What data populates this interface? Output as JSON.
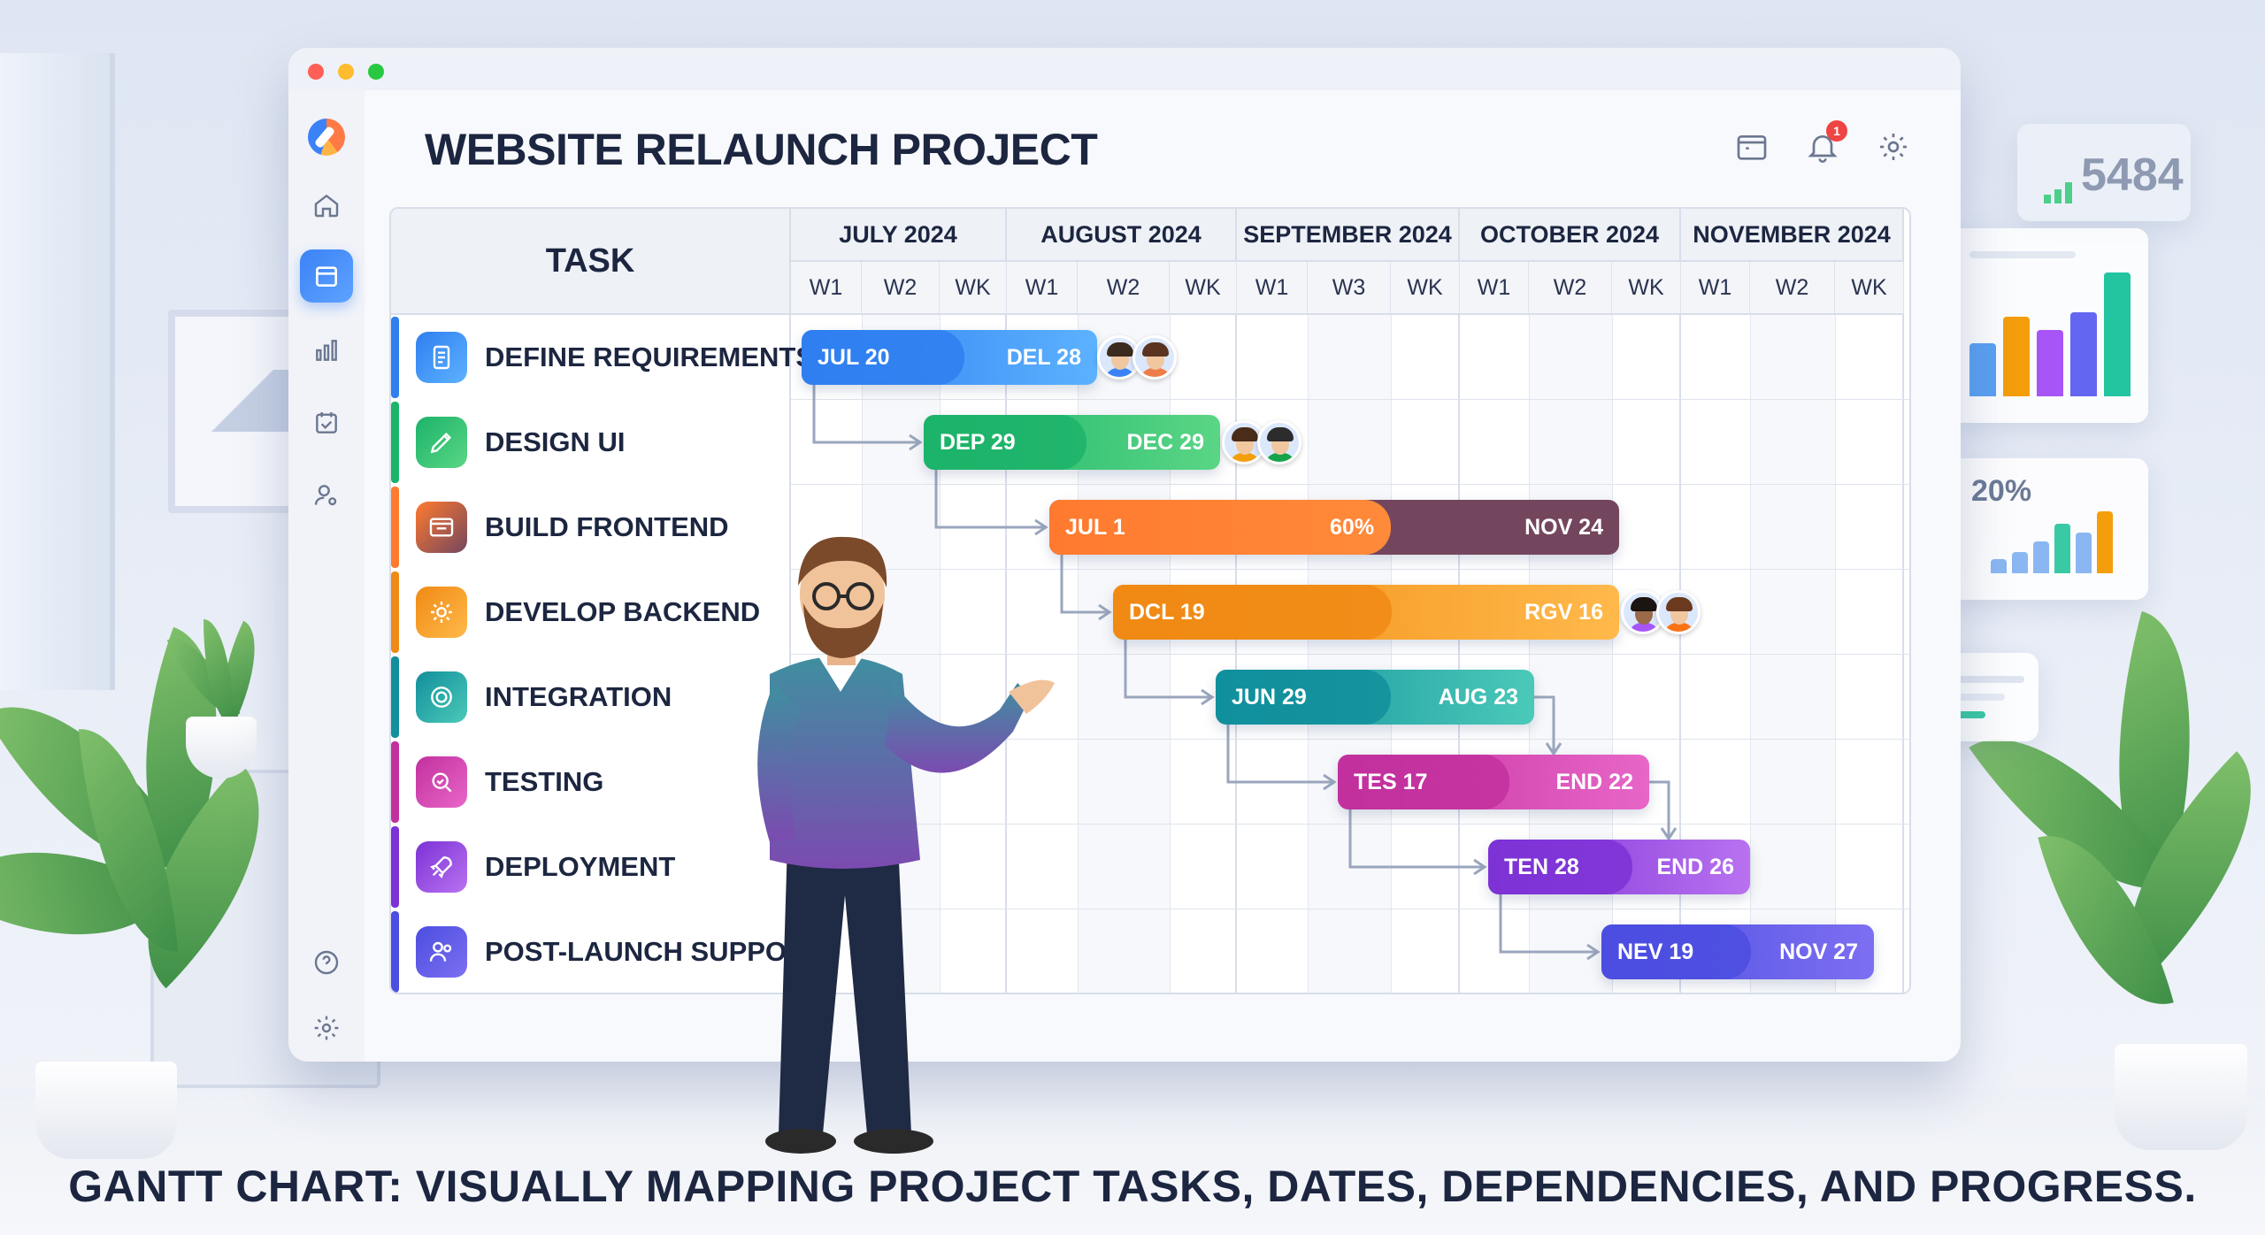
{
  "app": {
    "title": "WEBSITE RELAUNCH PROJECT",
    "notification_count": "1"
  },
  "background": {
    "stat_value": "5484",
    "stat_percent": "20%"
  },
  "gantt": {
    "task_header": "TASK",
    "months": [
      {
        "label": "JULY 2024",
        "weeks": [
          "W1",
          "W2",
          "WK"
        ]
      },
      {
        "label": "AUGUST 2024",
        "weeks": [
          "W1",
          "W2",
          "WK"
        ]
      },
      {
        "label": "SEPTEMBER 2024",
        "weeks": [
          "W1",
          "W3",
          "WK"
        ]
      },
      {
        "label": "OCTOBER 2024",
        "weeks": [
          "W1",
          "W2",
          "WK"
        ]
      },
      {
        "label": "NOVEMBER 2024",
        "weeks": [
          "W1",
          "W2",
          "WK"
        ]
      }
    ],
    "tasks": [
      {
        "name": "DEFINE REQUIREMENTS",
        "start_label": "JUL 20",
        "end_label": "DEL 28",
        "color": "#3b82f6",
        "icon": "document-icon"
      },
      {
        "name": "DESIGN UI",
        "start_label": "DEP 29",
        "end_label": "DEC 29",
        "color": "#22c55e",
        "icon": "pencil-icon"
      },
      {
        "name": "BUILD FRONTEND",
        "start_label": "JUL 1",
        "progress_label": "60%",
        "progress": 0.6,
        "end_label": "NOV 24",
        "color": "#f97316",
        "icon": "code-window-icon"
      },
      {
        "name": "DEVELOP BACKEND",
        "start_label": "DCL 19",
        "end_label": "RGV 16",
        "color": "#f59e0b",
        "icon": "gear-icon"
      },
      {
        "name": "INTEGRATION",
        "start_label": "JUN 29",
        "end_label": "AUG 23",
        "color": "#14b8a6",
        "icon": "cog-icon"
      },
      {
        "name": "TESTING",
        "start_label": "TES 17",
        "end_label": "END 22",
        "color": "#d946ef",
        "icon": "magnify-check-icon"
      },
      {
        "name": "DEPLOYMENT",
        "start_label": "TEN 28",
        "end_label": "END 26",
        "color": "#a855f7",
        "icon": "rocket-icon"
      },
      {
        "name": "POST-LAUNCH SUPPORT",
        "start_label": "NEV 19",
        "end_label": "NOV 27",
        "color": "#6366f1",
        "icon": "users-icon"
      }
    ]
  },
  "caption": "GANTT CHART: VISUALLY MAPPING PROJECT TASKS, DATES, DEPENDENCIES, AND PROGRESS."
}
